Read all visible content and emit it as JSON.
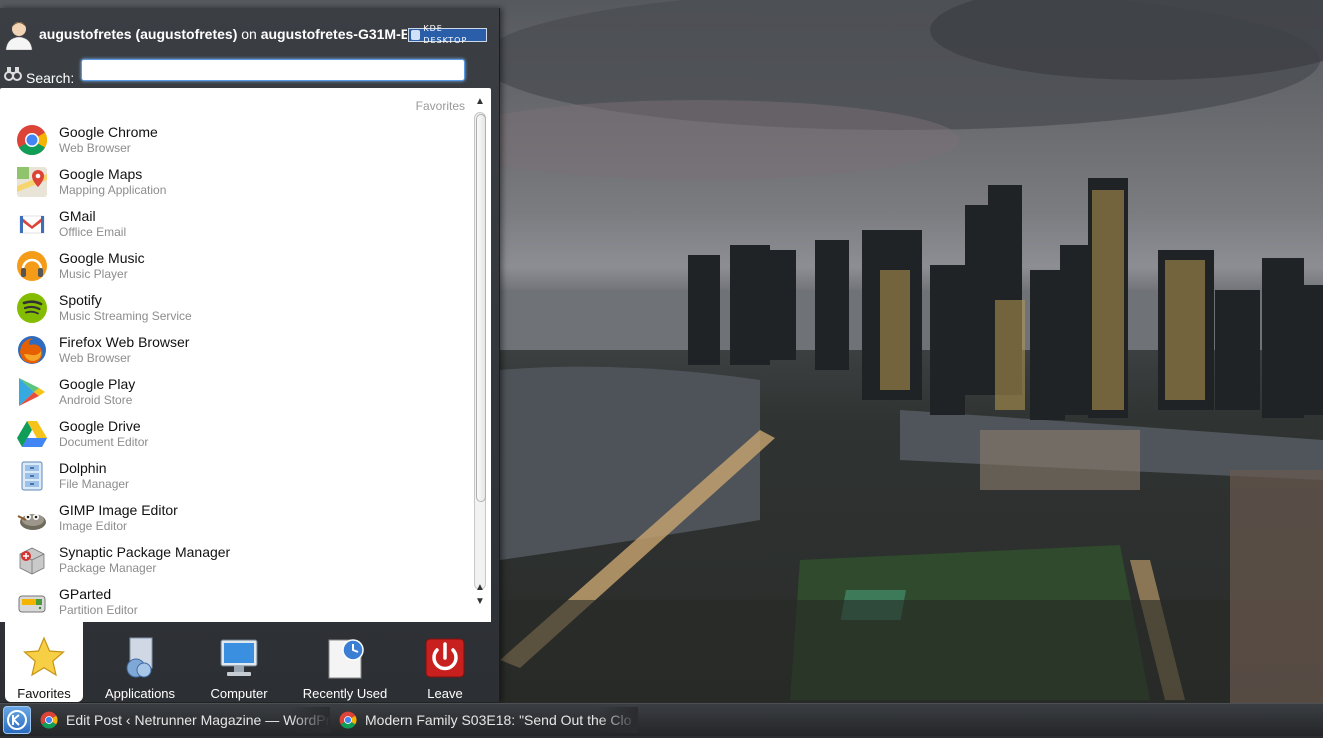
{
  "header": {
    "user": "augustofretes (augustofretes)",
    "on": "on",
    "host": "augustofretes-G31M-E",
    "badge": "KDE DESKTOP"
  },
  "search": {
    "label": "Search:",
    "value": "",
    "placeholder": ""
  },
  "list": {
    "title": "Favorites",
    "items": [
      {
        "name": "Google Chrome",
        "desc": "Web Browser",
        "icon": "chrome-icon"
      },
      {
        "name": "Google Maps",
        "desc": "Mapping Application",
        "icon": "maps-icon"
      },
      {
        "name": "GMail",
        "desc": "Offlice Email",
        "icon": "gmail-icon"
      },
      {
        "name": "Google Music",
        "desc": "Music Player",
        "icon": "headphones-icon"
      },
      {
        "name": "Spotify",
        "desc": "Music Streaming Service",
        "icon": "spotify-icon"
      },
      {
        "name": "Firefox Web Browser",
        "desc": "Web Browser",
        "icon": "firefox-icon"
      },
      {
        "name": "Google Play",
        "desc": "Android Store",
        "icon": "play-icon"
      },
      {
        "name": "Google Drive",
        "desc": "Document Editor",
        "icon": "drive-icon"
      },
      {
        "name": "Dolphin",
        "desc": "File Manager",
        "icon": "dolphin-icon"
      },
      {
        "name": "GIMP Image Editor",
        "desc": "Image Editor",
        "icon": "gimp-icon"
      },
      {
        "name": "Synaptic Package Manager",
        "desc": "Package Manager",
        "icon": "package-icon"
      },
      {
        "name": "GParted",
        "desc": "Partition Editor",
        "icon": "disk-icon"
      }
    ]
  },
  "tabs": [
    {
      "label": "Favorites",
      "icon": "star-icon",
      "active": true
    },
    {
      "label": "Applications",
      "icon": "applications-icon",
      "active": false
    },
    {
      "label": "Computer",
      "icon": "computer-icon",
      "active": false
    },
    {
      "label": "Recently Used",
      "icon": "clock-icon",
      "active": false
    },
    {
      "label": "Leave",
      "icon": "power-icon",
      "active": false
    }
  ],
  "taskbar": {
    "tasks": [
      {
        "label": "Edit Post ‹ Netrunner Magazine — WordPr",
        "icon": "chrome-icon"
      },
      {
        "label": "Modern Family S03E18: \"Send Out the Clo",
        "icon": "chrome-icon"
      }
    ]
  },
  "colors": {
    "accent": "#5b9be6",
    "menu_bg": "#2c2f33",
    "list_bg": "#ffffff",
    "leave_red": "#c8201e"
  }
}
